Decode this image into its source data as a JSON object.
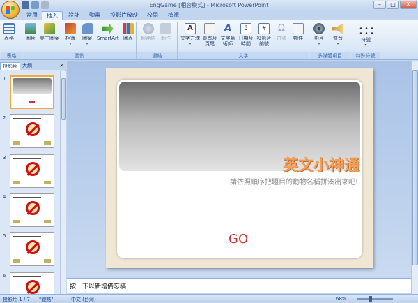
{
  "window": {
    "title": "EngGame [相容模式] - Microsoft PowerPoint",
    "controls": [
      "–",
      "□",
      "X"
    ]
  },
  "tabs": [
    "常用",
    "插入",
    "設計",
    "動畫",
    "投影片放映",
    "校閱",
    "檢視"
  ],
  "active_tab": "插入",
  "ribbon": {
    "groups": [
      {
        "label": "表格",
        "buttons": [
          {
            "label": "表格",
            "icon": "table-icon"
          }
        ]
      },
      {
        "label": "圖例",
        "buttons": [
          {
            "label": "圖片",
            "icon": "picture-icon"
          },
          {
            "label": "美工圖案",
            "icon": "clipart-icon"
          },
          {
            "label": "相簿",
            "icon": "photo-album-icon"
          },
          {
            "label": "圖案",
            "icon": "shapes-icon"
          },
          {
            "label": "SmartArt",
            "icon": "smartart-icon"
          },
          {
            "label": "圖表",
            "icon": "chart-icon"
          }
        ]
      },
      {
        "label": "連結",
        "buttons": [
          {
            "label": "超連結",
            "icon": "hyperlink-icon"
          },
          {
            "label": "動作",
            "icon": "action-icon"
          }
        ]
      },
      {
        "label": "文字",
        "buttons": [
          {
            "label": "文字方塊",
            "icon": "textbox-icon"
          },
          {
            "label": "頁首及頁尾",
            "icon": "header-footer-icon"
          },
          {
            "label": "文字藝術師",
            "icon": "wordart-icon"
          },
          {
            "label": "日期及時間",
            "icon": "datetime-icon"
          },
          {
            "label": "投影片編號",
            "icon": "slide-number-icon"
          },
          {
            "label": "符號",
            "icon": "symbol-icon"
          },
          {
            "label": "物件",
            "icon": "object-icon"
          }
        ]
      },
      {
        "label": "多媒體項目",
        "buttons": [
          {
            "label": "影片",
            "icon": "movie-icon"
          },
          {
            "label": "聲音",
            "icon": "sound-icon"
          }
        ]
      },
      {
        "label": "特殊符號",
        "buttons": [
          {
            "label": "符號",
            "icon": "special-symbol-icon"
          }
        ]
      }
    ]
  },
  "panel": {
    "tabs": [
      "投影片",
      "大綱"
    ],
    "close": "×",
    "thumbnails": [
      "1",
      "2",
      "3",
      "4",
      "5",
      "6"
    ]
  },
  "slide": {
    "title": "英文小神通",
    "subtitle": "請依照順序把題目的動物名稱拼湊出來吧!",
    "go": "GO"
  },
  "notes": "按一下以新增備忘稿",
  "status": {
    "slide": "投影片 1 / 7",
    "theme": "\"觀點\"",
    "language": "中文 (台灣)",
    "zoom": "68%"
  },
  "colors": {
    "accent": "#f0a05a",
    "go": "#c93535",
    "ribbon_text": "#15428b"
  }
}
